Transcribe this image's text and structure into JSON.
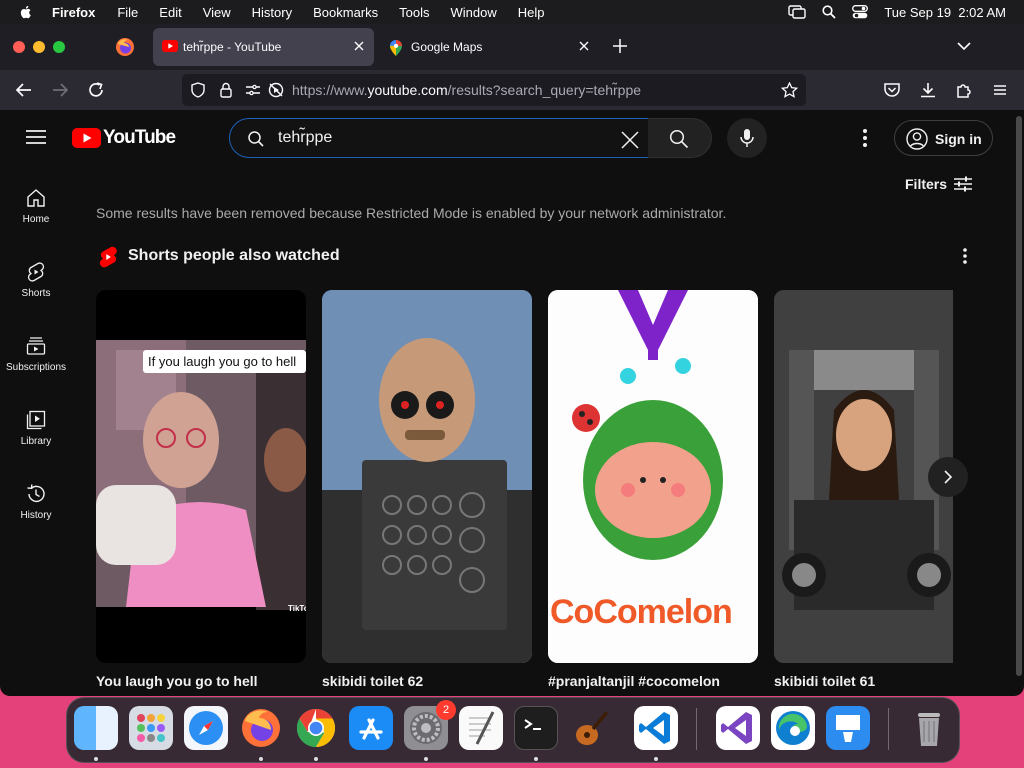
{
  "menubar": {
    "app": "Firefox",
    "items": [
      "File",
      "Edit",
      "View",
      "History",
      "Bookmarks",
      "Tools",
      "Window",
      "Help"
    ],
    "clock": "Tue Sep 19  2:02 AM"
  },
  "tabs": [
    {
      "title": "tehr̃ppe - YouTube",
      "active": true
    },
    {
      "title": "Google Maps",
      "active": false
    }
  ],
  "urlbar": {
    "prefix": "https://www.",
    "domain": "youtube.com",
    "path": "/results?search_query=tehr̃ppe"
  },
  "youtube": {
    "logo": "YouTube",
    "search_value": "tehr̃ppe",
    "signin_label": "Sign in",
    "filters_label": "Filters",
    "guide": [
      {
        "label": "Home",
        "icon": "home-icon"
      },
      {
        "label": "Shorts",
        "icon": "shorts-icon"
      },
      {
        "label": "Subscriptions",
        "icon": "subscriptions-icon"
      },
      {
        "label": "Library",
        "icon": "library-icon"
      },
      {
        "label": "History",
        "icon": "history-icon"
      }
    ],
    "notice": "Some results have been removed because Restricted Mode is enabled by your network administrator.",
    "shelf_title": "Shorts people also watched",
    "shorts": [
      {
        "title": "You laugh you go to hell",
        "caption": "If you laugh you go to hell",
        "watermark": "TikTok"
      },
      {
        "title": "skibidi toilet 62"
      },
      {
        "title": "#pranjaltanjil #cocomelon",
        "wordmark": "CoComelon"
      },
      {
        "title": "skibidi toilet 61"
      }
    ]
  },
  "dock": {
    "apps": [
      "Finder",
      "Launchpad",
      "Safari",
      "Firefox",
      "Chrome",
      "App Store",
      "System Settings",
      "TextEdit",
      "Terminal",
      "GarageBand",
      "Visual Studio Code",
      "Visual Studio",
      "Edge",
      "Keynote",
      "Trash"
    ],
    "settings_badge": "2"
  }
}
